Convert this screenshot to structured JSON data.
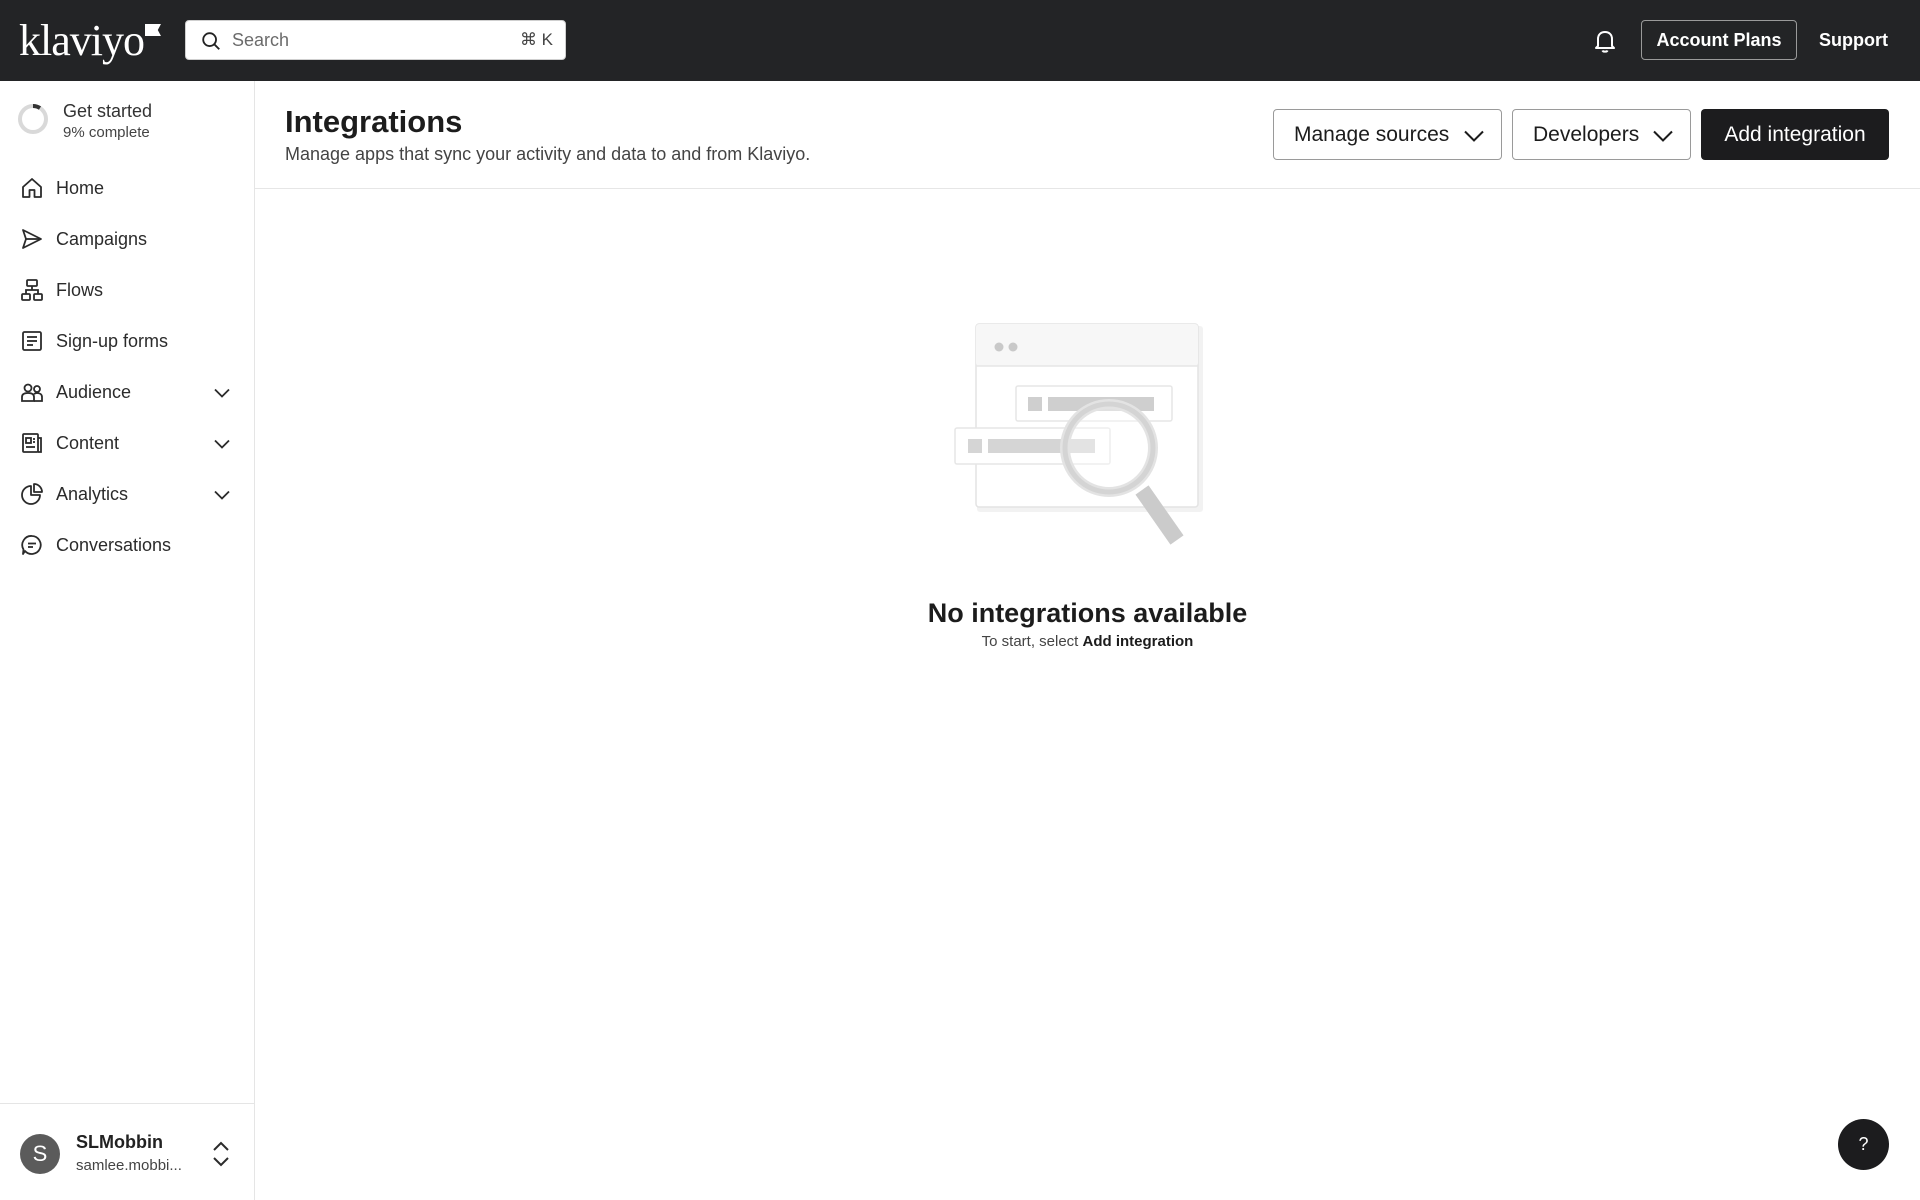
{
  "topbar": {
    "logo_text": "klaviyo",
    "search_placeholder": "Search",
    "search_shortcut": "⌘ K",
    "account_plans_label": "Account Plans",
    "support_label": "Support"
  },
  "sidebar": {
    "get_started": {
      "title": "Get started",
      "progress_text": "9% complete",
      "progress_percent": 9
    },
    "items": [
      {
        "label": "Home",
        "icon": "home-icon",
        "expandable": false
      },
      {
        "label": "Campaigns",
        "icon": "send-icon",
        "expandable": false
      },
      {
        "label": "Flows",
        "icon": "flow-icon",
        "expandable": false
      },
      {
        "label": "Sign-up forms",
        "icon": "form-icon",
        "expandable": false
      },
      {
        "label": "Audience",
        "icon": "users-icon",
        "expandable": true
      },
      {
        "label": "Content",
        "icon": "content-icon",
        "expandable": true
      },
      {
        "label": "Analytics",
        "icon": "pie-chart-icon",
        "expandable": true
      },
      {
        "label": "Conversations",
        "icon": "chat-icon",
        "expandable": false
      }
    ],
    "user": {
      "initial": "S",
      "name": "SLMobbin",
      "email": "samlee.mobbi..."
    }
  },
  "header": {
    "title": "Integrations",
    "subtitle": "Manage apps that sync your activity and data to and from Klaviyo.",
    "manage_sources_label": "Manage sources",
    "developers_label": "Developers",
    "add_integration_label": "Add integration"
  },
  "empty_state": {
    "title": "No integrations available",
    "subtitle_prefix": "To start, select ",
    "subtitle_action": "Add integration"
  },
  "help_label": "?",
  "colors": {
    "topbar": "#232426",
    "primary_button": "#1c1c1e",
    "text": "#1c1c1c"
  }
}
